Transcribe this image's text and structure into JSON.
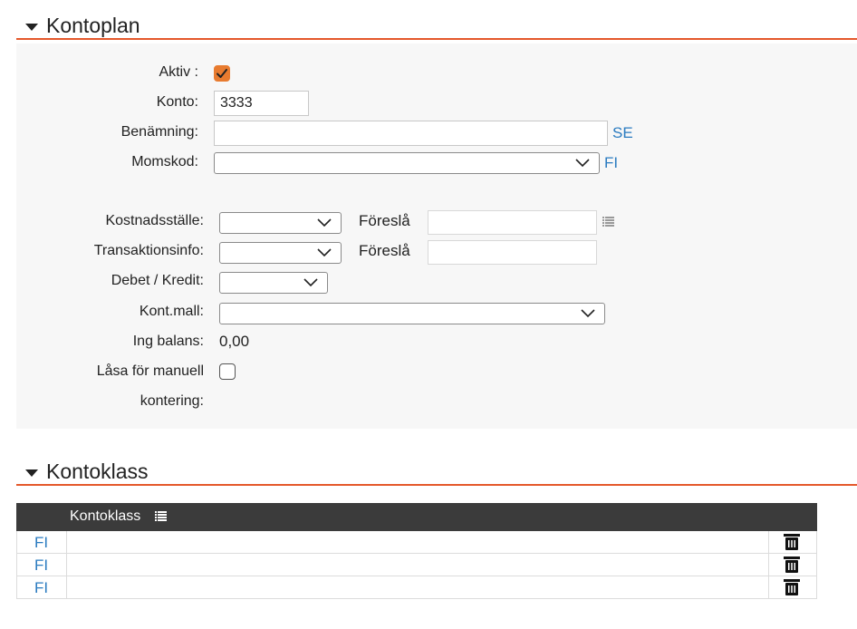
{
  "sections": {
    "kontoplan_title": "Kontoplan",
    "kontoklass_title": "Kontoklass"
  },
  "form": {
    "aktiv_label": "Aktiv :",
    "aktiv_checked": true,
    "konto_label": "Konto:",
    "konto_value": "3333",
    "benamning_label": "Benämning:",
    "benamning_value": "",
    "benamning_lang": "SE",
    "momskod_label": "Momskod:",
    "momskod_value": "",
    "momskod_lang": "FI",
    "kostnadsstalle_label": "Kostnadsställe:",
    "kostnadsstalle_value": "",
    "foresla1_label": "Föreslå",
    "foresla1_value": "",
    "transaktionsinfo_label": "Transaktionsinfo:",
    "transaktionsinfo_value": "",
    "foresla2_label": "Föreslå",
    "foresla2_value": "",
    "debet_kredit_label": "Debet / Kredit:",
    "debet_kredit_value": "",
    "kontmall_label": "Kont.mall:",
    "kontmall_value": "",
    "ing_balans_label": "Ing balans:",
    "ing_balans_value": "0,00",
    "lasa_label_line1": "Låsa för manuell",
    "lasa_label_line2": "kontering:",
    "lasa_checked": false
  },
  "table": {
    "header": "Kontoklass",
    "rows": [
      {
        "lang": "FI",
        "value": ""
      },
      {
        "lang": "FI",
        "value": ""
      },
      {
        "lang": "FI",
        "value": ""
      }
    ]
  },
  "colors": {
    "accent": "#e4582b",
    "checkbox": "#e87b2f",
    "link": "#2a7bc0",
    "table_header": "#3b3b3b"
  },
  "icons": [
    "collapse-triangle-icon",
    "checkmark-icon",
    "chevron-down-icon",
    "list-icon",
    "trash-icon"
  ]
}
